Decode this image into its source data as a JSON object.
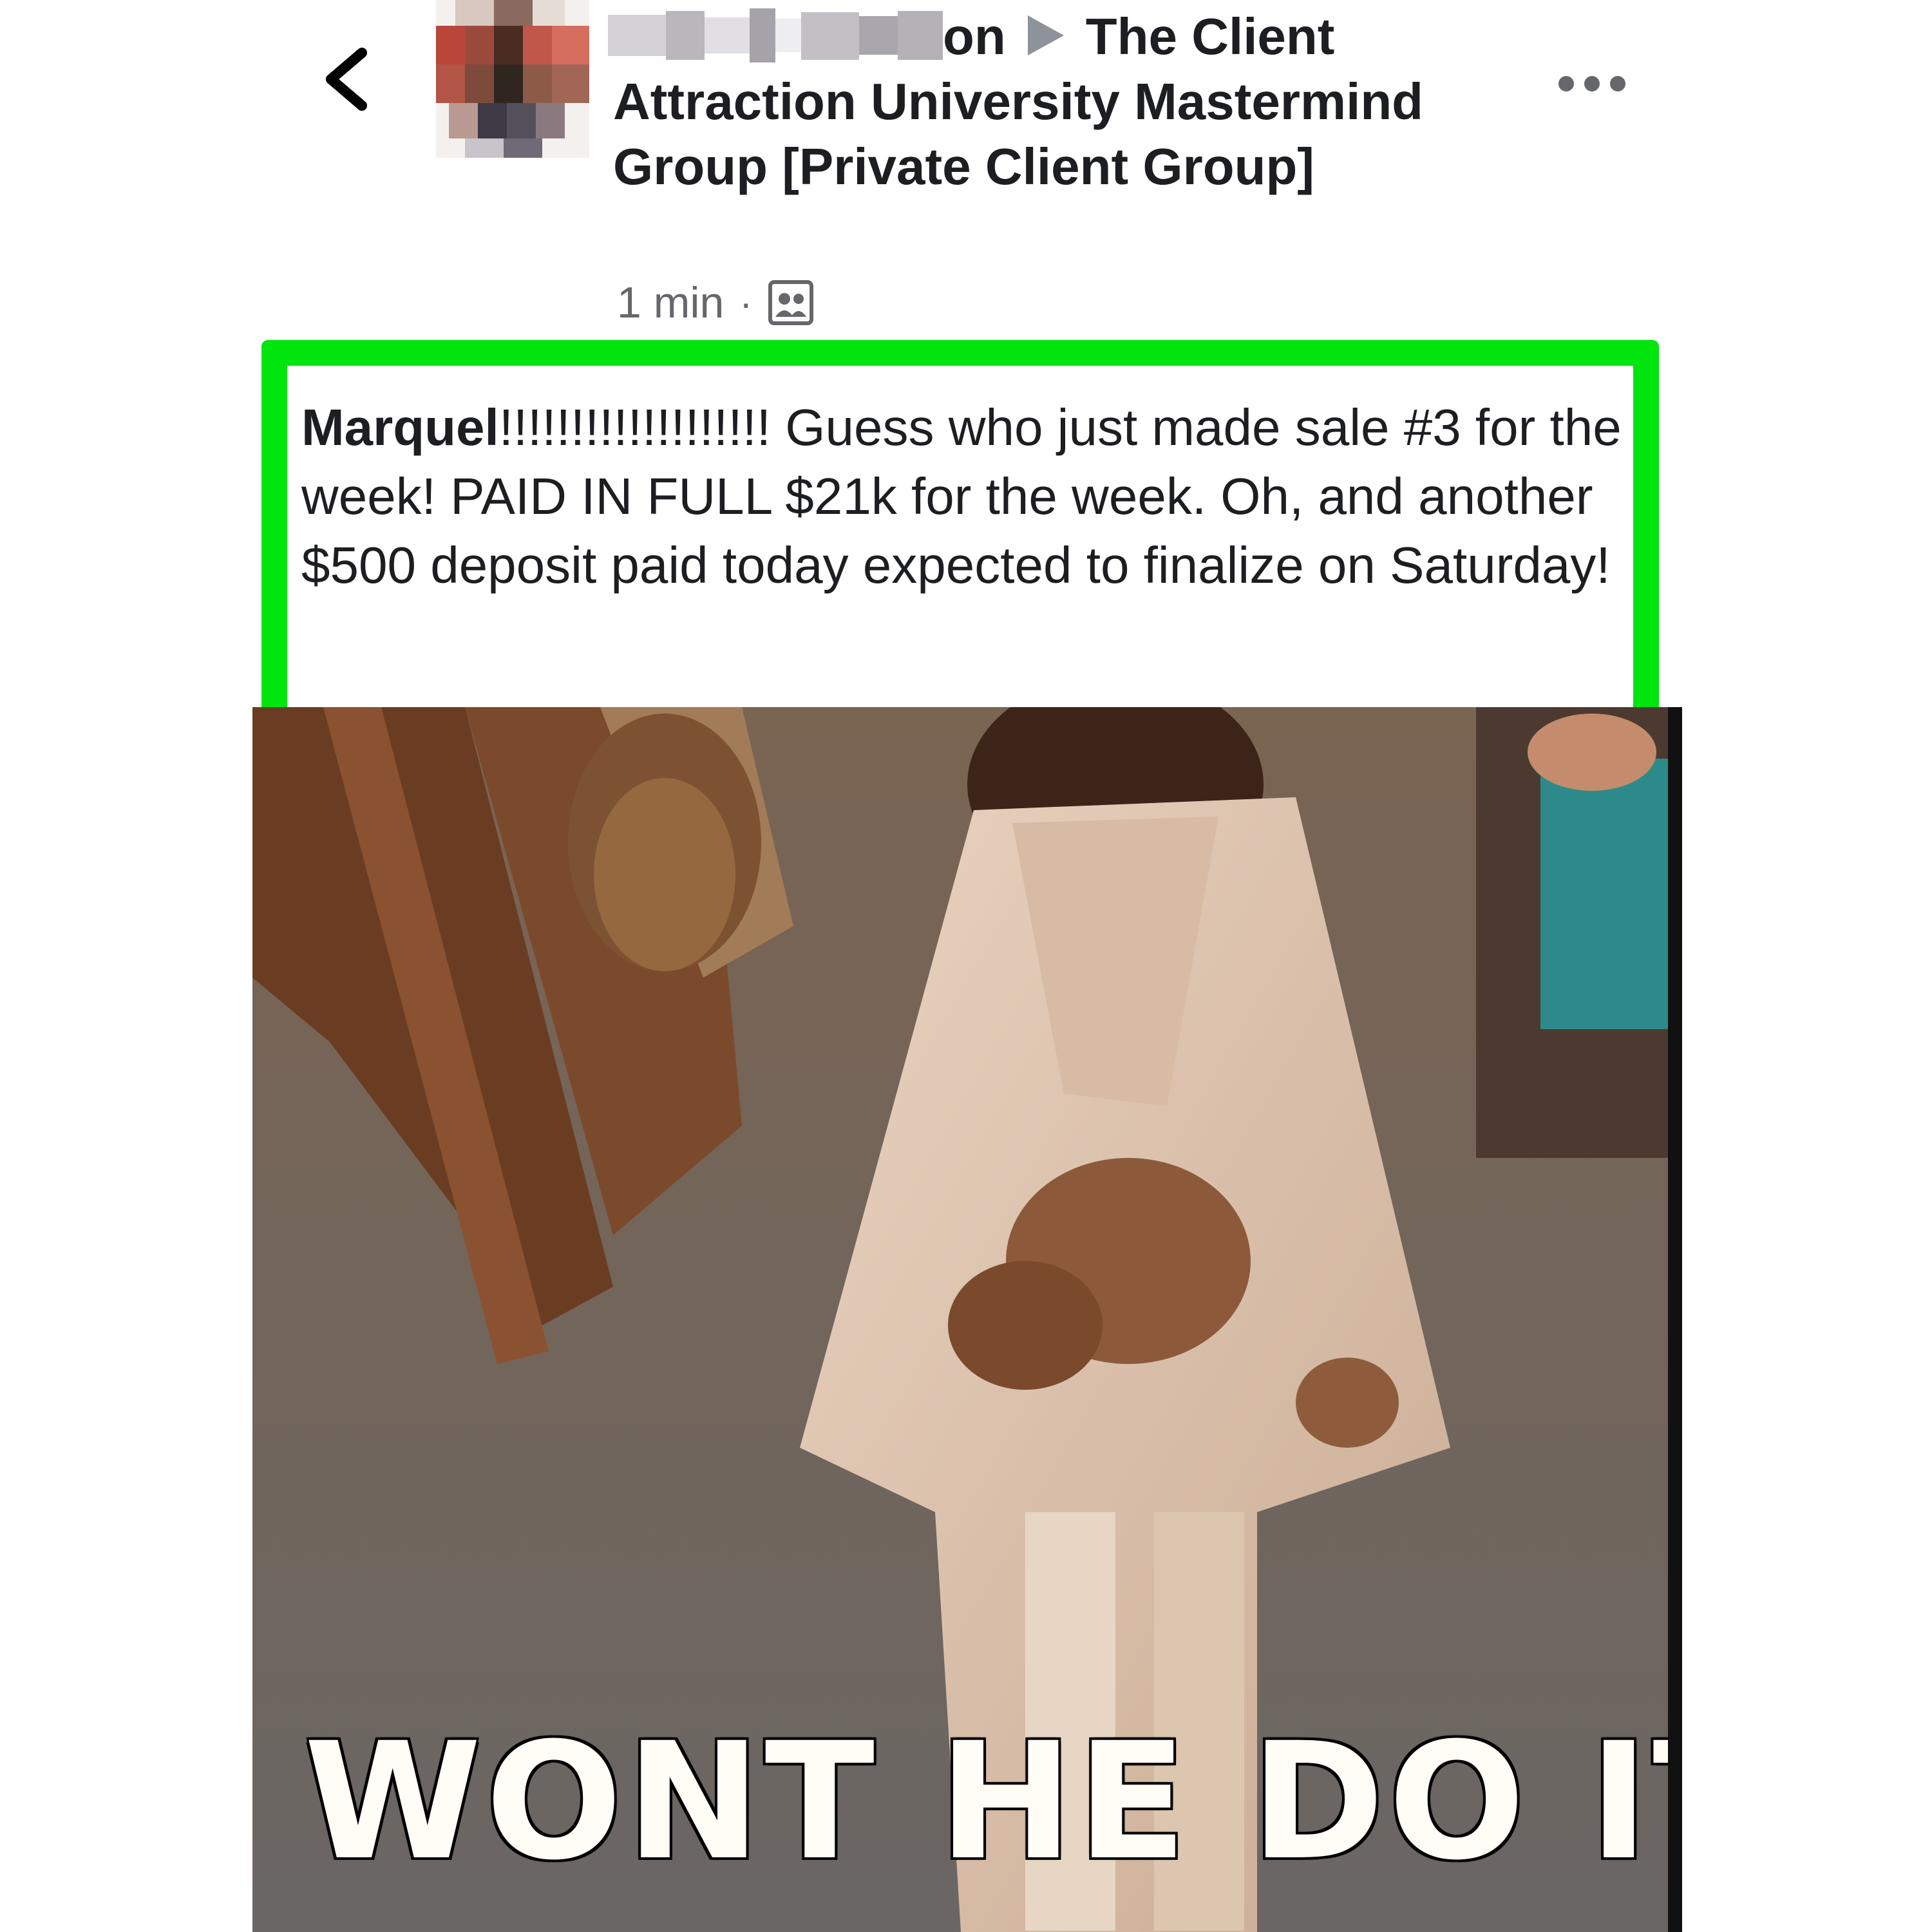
{
  "header": {
    "author_visible_suffix": "on",
    "group_name": "The Client Attraction University Mastermind Group [Private Client Group]",
    "timestamp": "1 min",
    "separator": "·",
    "privacy_icon": "group-members-icon",
    "back_icon": "chevron-left-icon",
    "more_icon": "more-horizontal-icon"
  },
  "post": {
    "mention": "Marquel",
    "text": "!!!!!!!!!!!!!!!!!!!   Guess who just made sale #3 for the week!  PAID IN FULL $21k for the week.  Oh, and another $500 deposit paid today expected to finalize on Saturday!"
  },
  "gif": {
    "caption": "WONT HE DO IT!"
  },
  "colors": {
    "highlight": "#00e50d",
    "text": "#1c1e21",
    "meta": "#65676b"
  }
}
